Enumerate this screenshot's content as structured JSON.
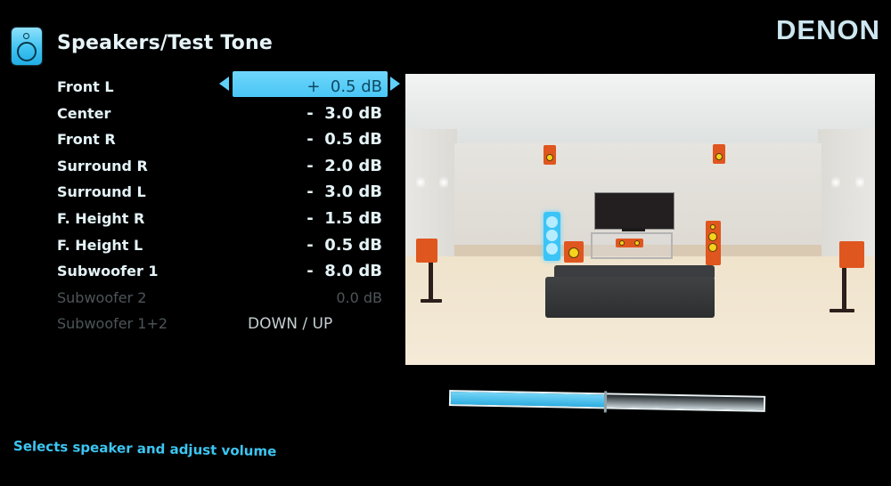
{
  "header": {
    "icon": "speaker-icon",
    "title": "Speakers/Test Tone",
    "brand": "DENON"
  },
  "channels": [
    {
      "label": "Front L",
      "value": "+  0.5 dB",
      "selected": true,
      "enabled": true
    },
    {
      "label": "Center",
      "value": "-  3.0 dB",
      "selected": false,
      "enabled": true
    },
    {
      "label": "Front R",
      "value": "-  0.5 dB",
      "selected": false,
      "enabled": true
    },
    {
      "label": "Surround R",
      "value": "-  2.0 dB",
      "selected": false,
      "enabled": true
    },
    {
      "label": "Surround L",
      "value": "-  3.0 dB",
      "selected": false,
      "enabled": true
    },
    {
      "label": "F. Height R",
      "value": "-  1.5 dB",
      "selected": false,
      "enabled": true
    },
    {
      "label": "F. Height L",
      "value": "-  0.5 dB",
      "selected": false,
      "enabled": true
    },
    {
      "label": "Subwoofer 1",
      "value": "-  8.0 dB",
      "selected": false,
      "enabled": true
    },
    {
      "label": "Subwoofer 2",
      "value": "0.0 dB",
      "selected": false,
      "enabled": false
    },
    {
      "label": "Subwoofer 1+2",
      "value": "DOWN / UP",
      "selected": false,
      "enabled": false
    }
  ],
  "selection": {
    "left_arrow_icon": "arrow-left-icon",
    "right_arrow_icon": "arrow-right-icon"
  },
  "room": {
    "highlighted_speaker": "Front L",
    "speakers": [
      "Front L",
      "Center",
      "Front R",
      "Surround R",
      "Surround L",
      "F. Height R",
      "F. Height L",
      "Subwoofer 1"
    ]
  },
  "level_bar": {
    "fill_fraction": 0.49,
    "center_fraction": 0.49
  },
  "help_text": "Selects speaker and adjust volume",
  "colors": {
    "accent": "#49c6f5",
    "speaker": "#e0561f",
    "help_text": "#3cc6f2",
    "disabled_text": "#4d5558"
  }
}
